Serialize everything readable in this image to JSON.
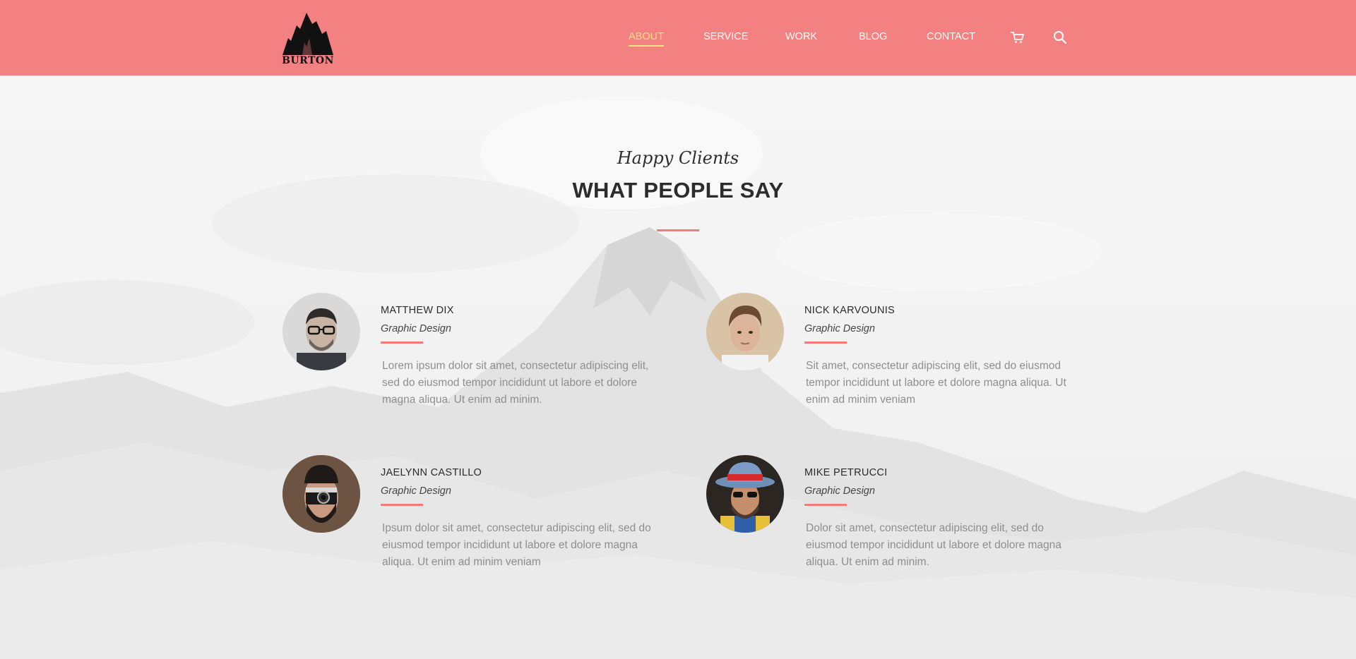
{
  "header": {
    "logo_text": "BURTON",
    "nav": [
      {
        "label": "ABOUT",
        "active": true
      },
      {
        "label": "SERVICE",
        "active": false
      },
      {
        "label": "WORK",
        "active": false
      },
      {
        "label": "BLOG",
        "active": false
      },
      {
        "label": "CONTACT",
        "active": false
      }
    ],
    "icons": [
      "cart-icon",
      "search-icon"
    ]
  },
  "section": {
    "script_title": "Happy Clients",
    "title": "WHAT PEOPLE SAY"
  },
  "testimonials": [
    {
      "name": "MATTHEW DIX",
      "role": "Graphic Design",
      "text": "Lorem ipsum dolor sit amet, consectetur adipiscing elit, sed do eiusmod tempor incididunt ut labore et dolore magna aliqua. Ut enim ad minim."
    },
    {
      "name": "NICK KARVOUNIS",
      "role": "Graphic Design",
      "text": "Sit amet, consectetur adipiscing elit, sed do eiusmod tempor incididunt ut labore et dolore magna aliqua. Ut enim ad minim veniam"
    },
    {
      "name": "JAELYNN CASTILLO",
      "role": "Graphic Design",
      "text": "Ipsum dolor sit amet, consectetur adipiscing elit, sed do eiusmod tempor incididunt ut labore et dolore magna aliqua. Ut enim ad minim veniam"
    },
    {
      "name": "MIKE PETRUCCI",
      "role": "Graphic Design",
      "text": "Dolor sit amet, consectetur adipiscing elit, sed do eiusmod tempor incididunt ut labore et dolore magna aliqua. Ut enim ad minim."
    }
  ],
  "colors": {
    "header_bg": "#f48181",
    "nav_active": "#fbe08a",
    "accent": "#f27a7a"
  }
}
